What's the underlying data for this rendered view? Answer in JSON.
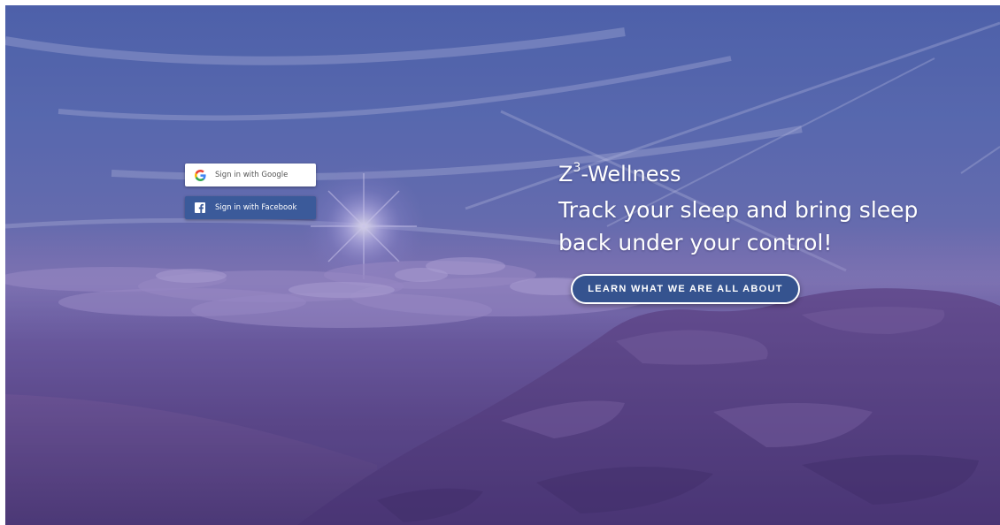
{
  "auth": {
    "google_label": "Sign in with Google",
    "facebook_label": "Sign in with Facebook"
  },
  "hero": {
    "brand_prefix": "Z",
    "brand_superscript": "3",
    "brand_suffix": "-Wellness",
    "tagline_line1": "Track your sleep and bring sleep",
    "tagline_line2": "back under your control!",
    "cta_label": "LEARN WHAT WE ARE ALL ABOUT"
  },
  "icons": {
    "google": "google-g-icon",
    "facebook": "facebook-f-icon"
  },
  "colors": {
    "facebook_blue": "#3b5a9a",
    "cta_fill": "#35538f",
    "sky_top": "#4f6bb0",
    "mountain_purple": "#503d78"
  }
}
